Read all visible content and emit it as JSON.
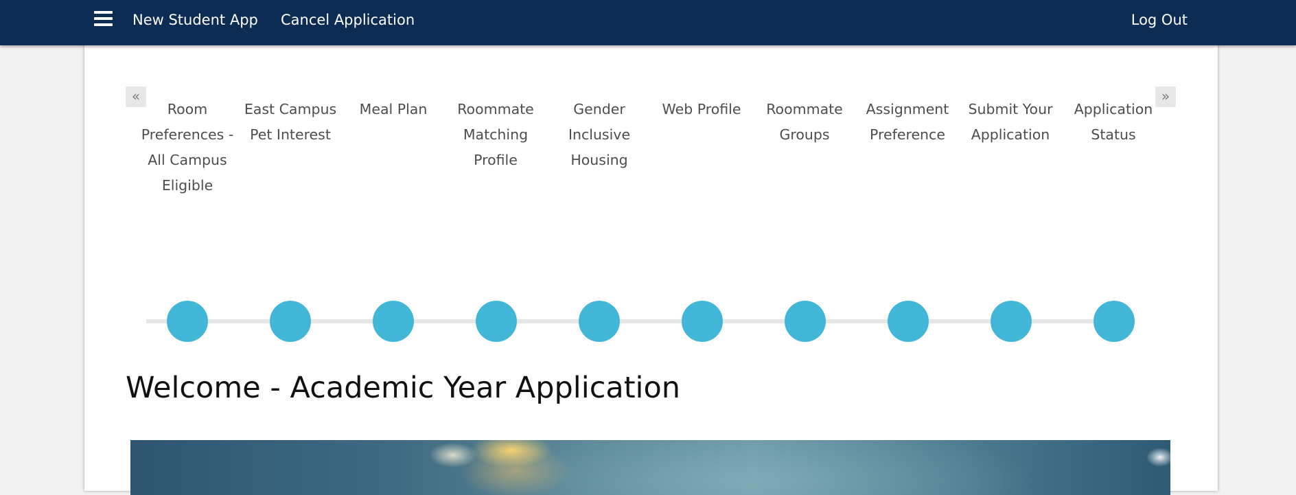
{
  "navbar": {
    "menu_icon": "hamburger-menu-icon",
    "links": {
      "new_student_app": "New Student App",
      "cancel_application": "Cancel Application",
      "log_out": "Log Out"
    },
    "background_color": "#0c2c53"
  },
  "carousel": {
    "prev_icon": "double-chevron-left-icon",
    "next_icon": "double-chevron-right-icon",
    "prev_glyph": "«",
    "next_glyph": "»",
    "steps": [
      {
        "label": "Room Preferences - All Campus Eligible"
      },
      {
        "label": "East Campus Pet Interest"
      },
      {
        "label": "Meal Plan"
      },
      {
        "label": "Roommate Matching Profile"
      },
      {
        "label": "Gender Inclusive Housing"
      },
      {
        "label": "Web Profile"
      },
      {
        "label": "Roommate Groups"
      },
      {
        "label": "Assignment Preference"
      },
      {
        "label": "Submit Your Application"
      },
      {
        "label": "Application Status"
      }
    ],
    "dot_color": "#41b6d6"
  },
  "main": {
    "title": "Welcome - Academic Year Application"
  }
}
